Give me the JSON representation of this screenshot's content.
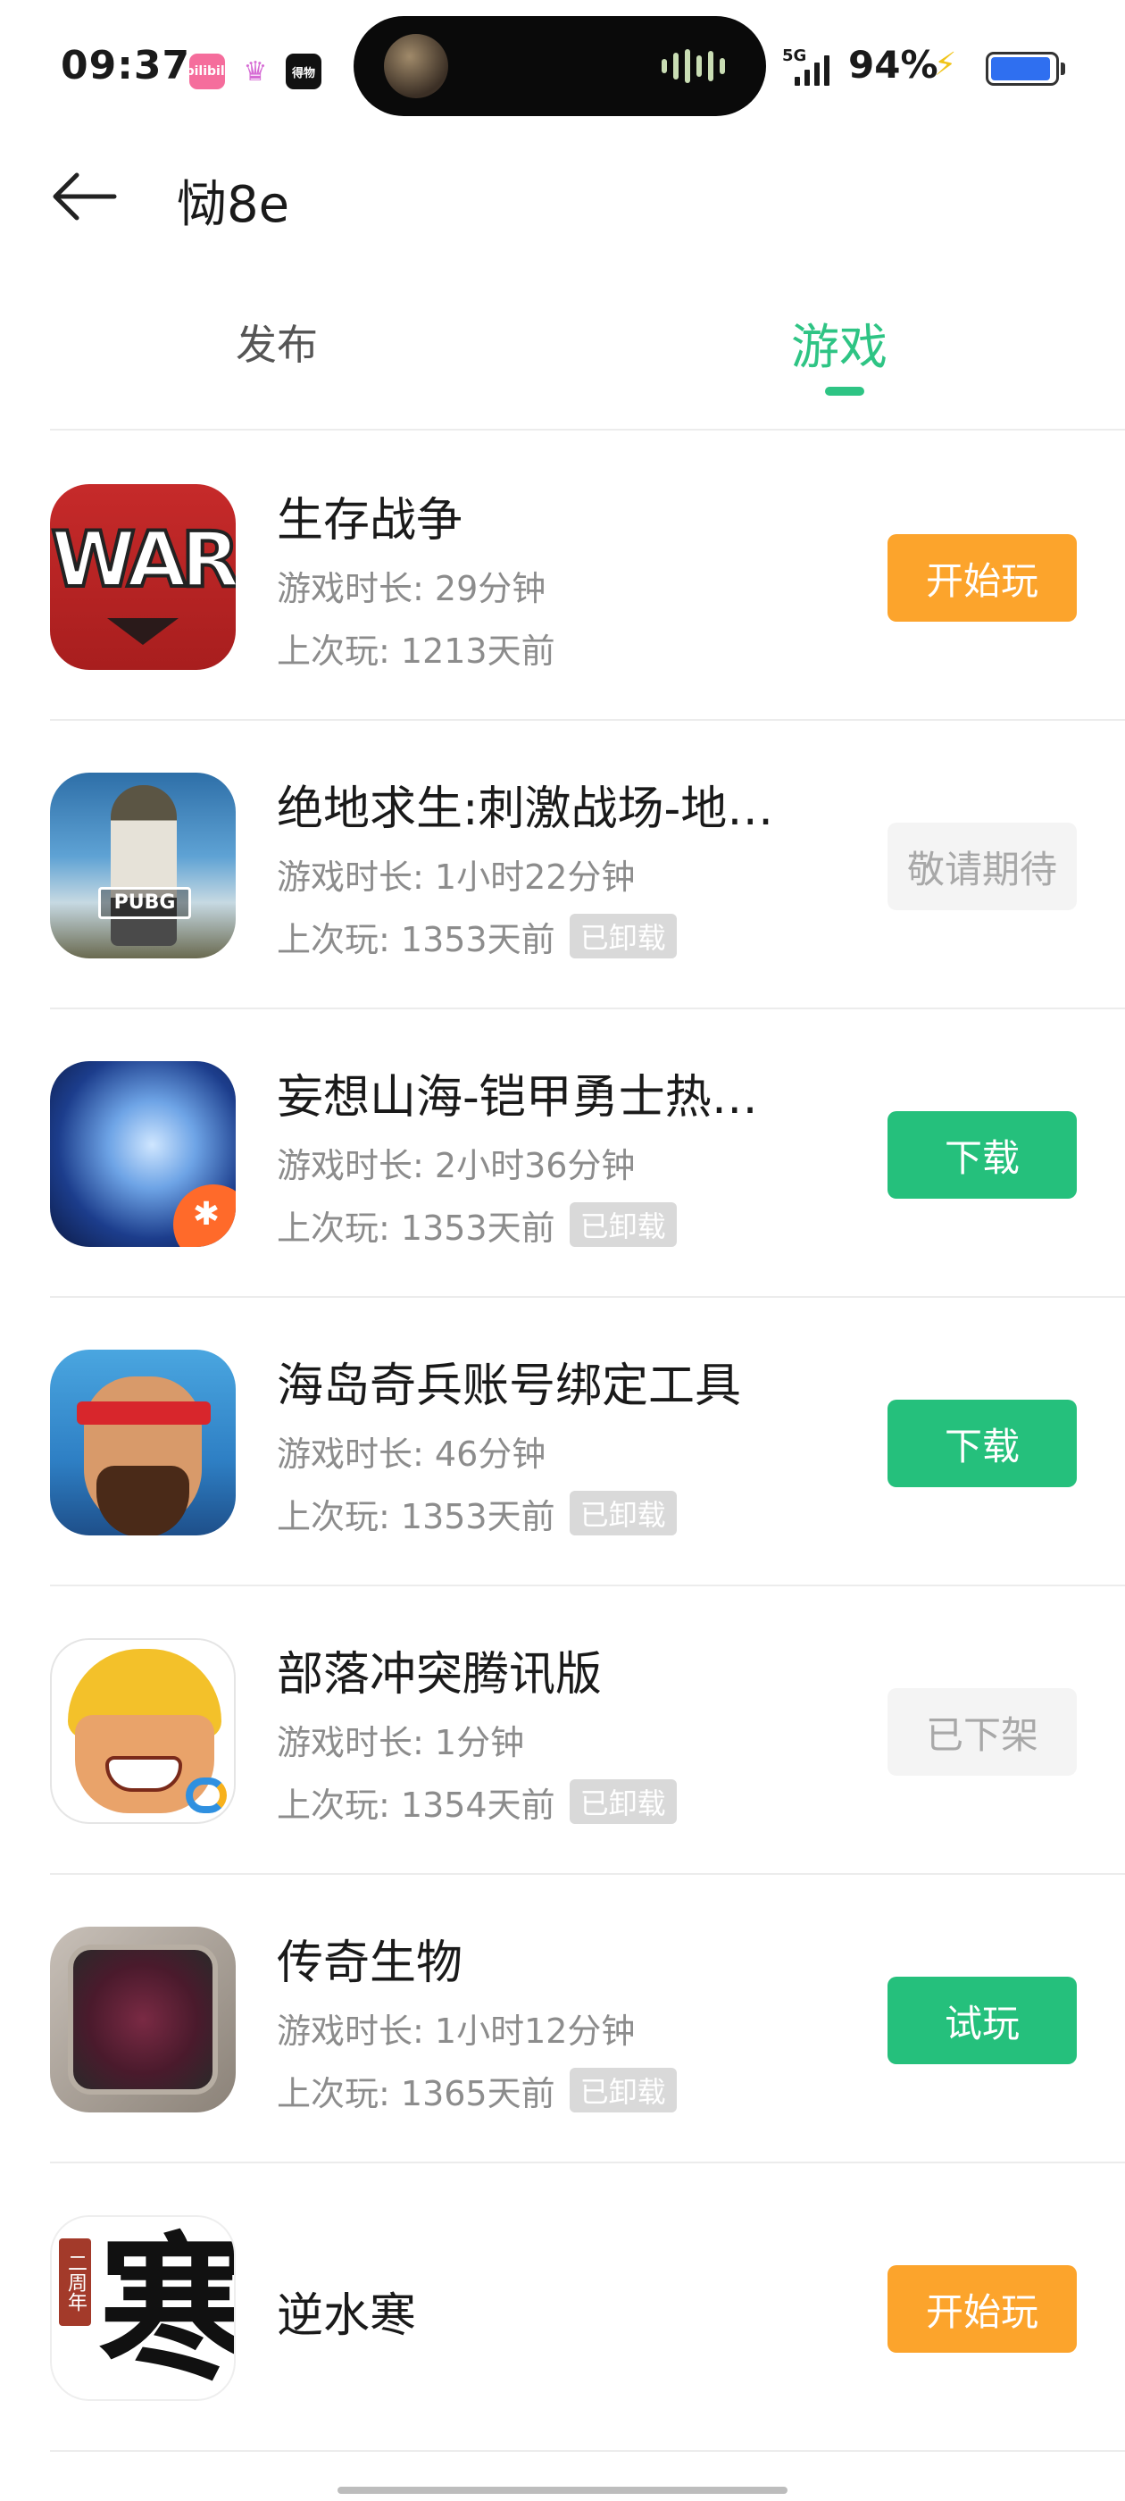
{
  "status_bar": {
    "time": "09:37",
    "apps": [
      "bilibili-icon",
      "crown-icon",
      "dewu-icon"
    ],
    "bilibili_label": "bilibili",
    "dewu_label": "得物",
    "network": "5G",
    "battery_percent": "94%",
    "battery_level": 0.94,
    "charging": true
  },
  "header": {
    "title": "恸8e",
    "back_icon": "arrow-left-icon"
  },
  "tabs": [
    {
      "label": "发布",
      "active": false
    },
    {
      "label": "游戏",
      "active": true
    }
  ],
  "colors": {
    "accent_green": "#2ec484",
    "button_orange": "#fca42c",
    "button_green": "#25c07c",
    "button_gray_bg": "#f4f4f4",
    "meta_gray": "#8c8c8c",
    "badge_gray": "#d9d9d9"
  },
  "labels": {
    "duration_prefix": "游戏时长: ",
    "last_played_prefix": "上次玩: "
  },
  "games": [
    {
      "name": "生存战争",
      "duration": "29分钟",
      "last_played": "1213天前",
      "badge": "",
      "button": "开始玩",
      "button_style": "orange",
      "icon": "war-icon",
      "icon_text": "WAR"
    },
    {
      "name": "绝地求生:刺激战场-地…",
      "duration": "1小时22分钟",
      "last_played": "1353天前",
      "badge": "已卸载",
      "button": "敬请期待",
      "button_style": "gray",
      "icon": "pubg-icon",
      "icon_text": "PUBG"
    },
    {
      "name": "妄想山海-铠甲勇士热…",
      "duration": "2小时36分钟",
      "last_played": "1353天前",
      "badge": "已卸载",
      "button": "下载",
      "button_style": "green",
      "icon": "wangxiang-icon",
      "icon_text": ""
    },
    {
      "name": "海岛奇兵账号绑定工具",
      "duration": "46分钟",
      "last_played": "1353天前",
      "badge": "已卸载",
      "button": "下载",
      "button_style": "green",
      "icon": "boom-beach-icon",
      "icon_text": ""
    },
    {
      "name": "部落冲突腾讯版",
      "duration": "1分钟",
      "last_played": "1354天前",
      "badge": "已卸载",
      "button": "已下架",
      "button_style": "gray",
      "icon": "clash-of-clans-icon",
      "icon_text": ""
    },
    {
      "name": "传奇生物",
      "duration": "1小时12分钟",
      "last_played": "1365天前",
      "badge": "已卸载",
      "button": "试玩",
      "button_style": "green",
      "icon": "legendary-creatures-icon",
      "icon_text": ""
    },
    {
      "name": "逆水寒",
      "duration": "",
      "last_played": "",
      "badge": "",
      "button": "开始玩",
      "button_style": "orange",
      "icon": "nishuihan-icon",
      "icon_text": "寒",
      "icon_badge": "二周年"
    }
  ]
}
